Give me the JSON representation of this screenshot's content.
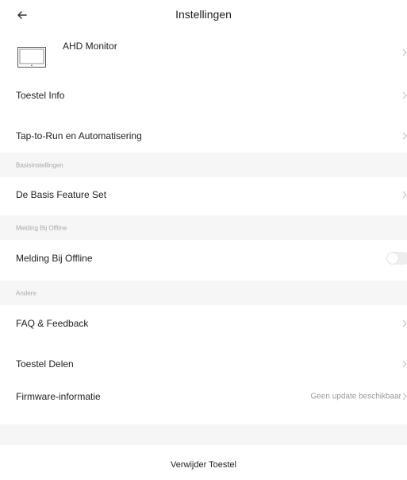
{
  "header": {
    "title": "Instellingen"
  },
  "device": {
    "name": "AHD Monitor"
  },
  "rows": {
    "device_info": "Toestel Info",
    "tap_to_run": "Tap-to-Run en Automatisering",
    "basic_feature_set": "De Basis Feature Set",
    "offline_notification": "Melding Bij Offline",
    "faq": "FAQ & Feedback",
    "share_device": "Toestel Delen",
    "firmware": "Firmware-informatie",
    "firmware_status": "Geen update beschikbaar"
  },
  "sections": {
    "basic": "Basisinstellingen",
    "offline": "Melding Bij Offline",
    "other": "Andere"
  },
  "toggles": {
    "offline_notification_on": false
  },
  "footer": {
    "remove_label": "Verwijder Toestel"
  },
  "icons": {
    "back": "arrow-left-icon",
    "chevron": "chevron-right-icon",
    "device": "monitor-icon"
  },
  "colors": {
    "section_bg": "#f6f6f6",
    "muted_text": "#a9a9a9",
    "toggle_off": "#eeeeee"
  }
}
